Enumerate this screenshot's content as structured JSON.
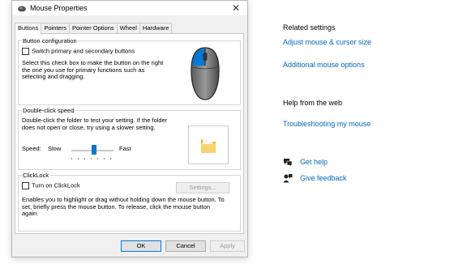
{
  "dialog": {
    "title": "Mouse Properties",
    "close_glyph": "✕",
    "tabs": [
      "Buttons",
      "Pointers",
      "Pointer Options",
      "Wheel",
      "Hardware"
    ],
    "button_config": {
      "legend": "Button configuration",
      "checkbox_label": "Switch primary and secondary buttons",
      "description": "Select this check box to make the button on the right the one you use for primary functions such as selecting and dragging."
    },
    "double_click": {
      "legend": "Double-click speed",
      "description": "Double-click the folder to test your setting. If the folder does not open or close, try using a slower setting.",
      "speed_label": "Speed:",
      "slow_label": "Slow",
      "fast_label": "Fast",
      "speed_value": 0.5
    },
    "clicklock": {
      "legend": "ClickLock",
      "checkbox_label": "Turn on ClickLock",
      "settings_button": "Settings...",
      "description": "Enables you to highlight or drag without holding down the mouse button. To set, briefly press the mouse button. To release, click the mouse button again."
    },
    "buttons": {
      "ok": "OK",
      "cancel": "Cancel",
      "apply": "Apply"
    }
  },
  "related": {
    "heading": "Related settings",
    "links": [
      "Adjust mouse & cursor size",
      "Additional mouse options"
    ]
  },
  "help": {
    "heading": "Help from the web",
    "links": [
      "Troubleshooting my mouse"
    ]
  },
  "support": [
    {
      "icon": "get-help-icon",
      "label": "Get help"
    },
    {
      "icon": "feedback-icon",
      "label": "Give feedback"
    }
  ],
  "colors": {
    "accent": "#0078d7",
    "link": "#0067b8"
  }
}
